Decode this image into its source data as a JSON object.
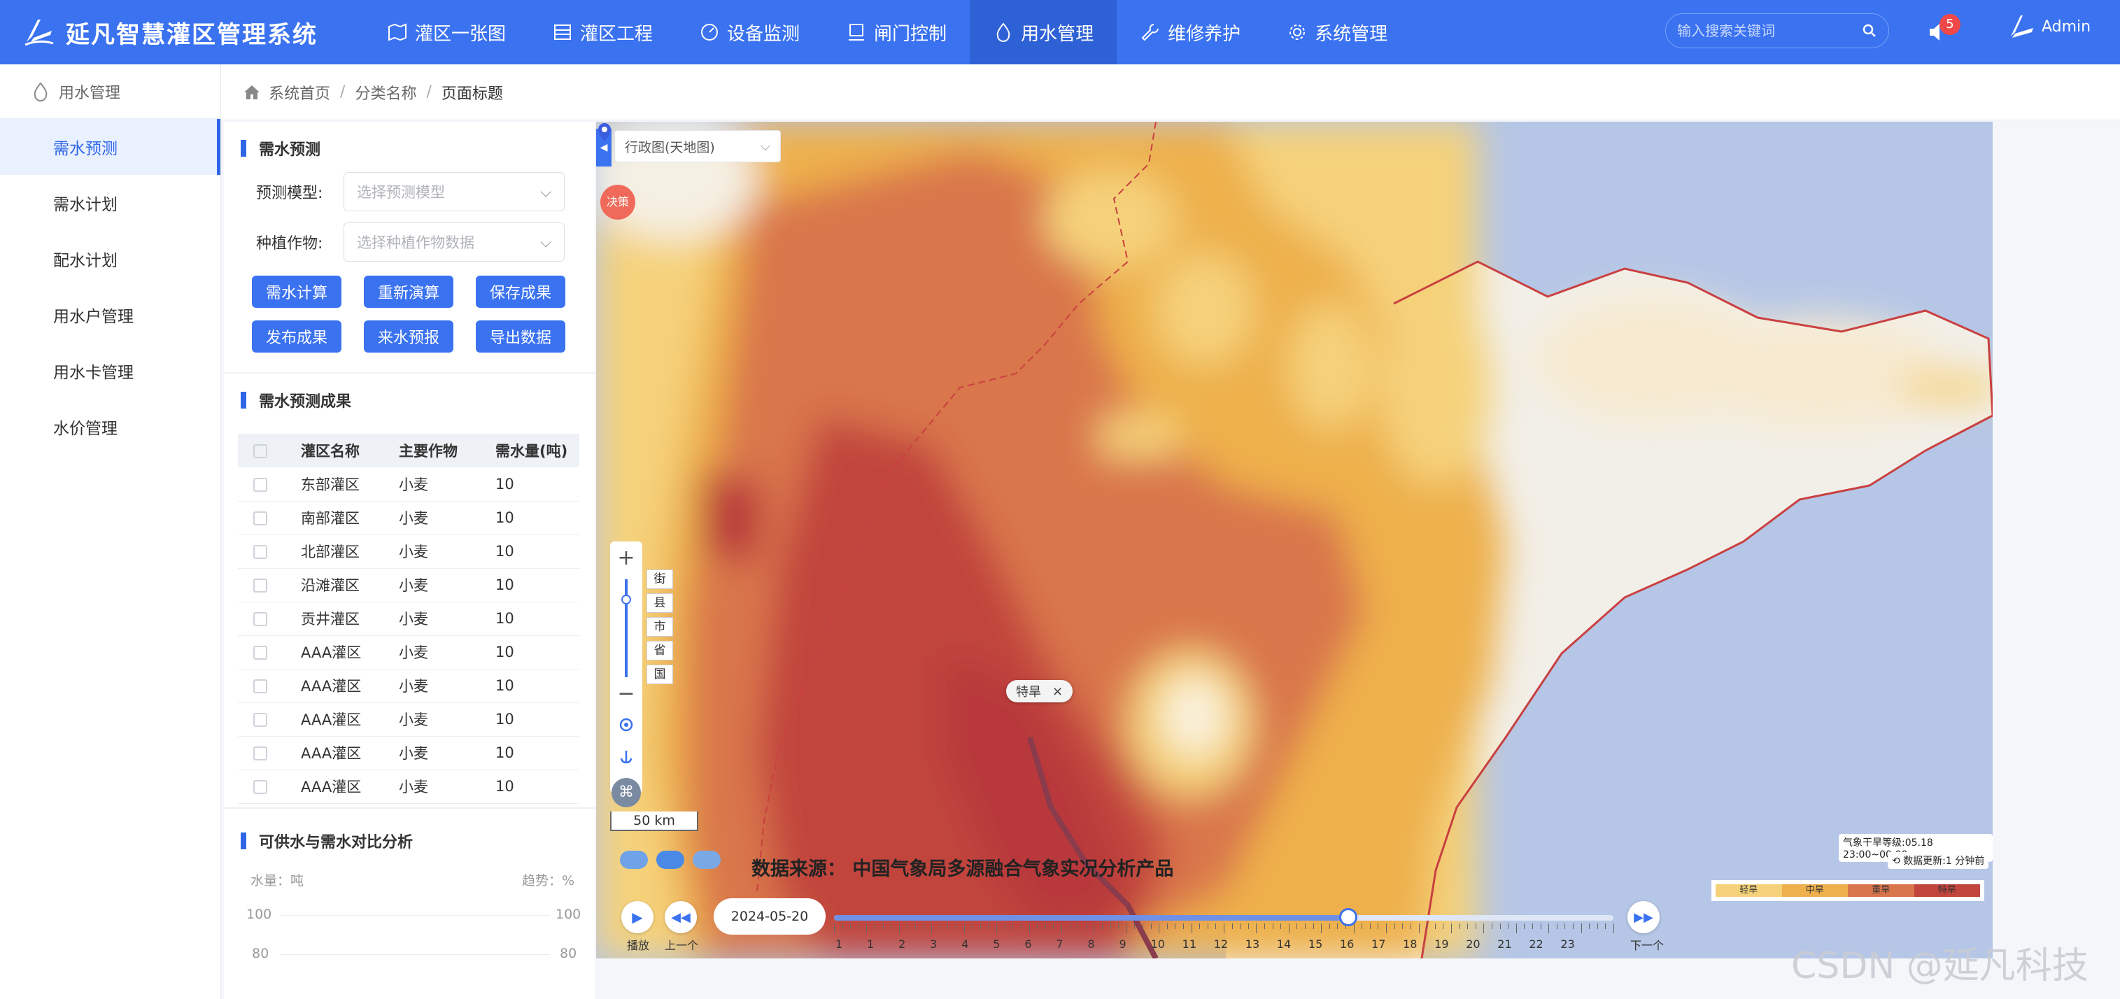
{
  "app": {
    "title": "延凡智慧灌区管理系统"
  },
  "nav": [
    {
      "label": "灌区一张图",
      "icon": "map-icon"
    },
    {
      "label": "灌区工程",
      "icon": "building-icon"
    },
    {
      "label": "设备监测",
      "icon": "monitor-icon"
    },
    {
      "label": "闸门控制",
      "icon": "gate-icon"
    },
    {
      "label": "用水管理",
      "icon": "water-drop-icon",
      "active": true
    },
    {
      "label": "维修养护",
      "icon": "wrench-icon"
    },
    {
      "label": "系统管理",
      "icon": "gear-icon"
    }
  ],
  "search": {
    "placeholder": "输入搜索关键词"
  },
  "notifications": {
    "count": "5"
  },
  "user": {
    "name": "Admin"
  },
  "sidebar": {
    "header": "用水管理",
    "items": [
      {
        "label": "需水预测",
        "active": true
      },
      {
        "label": "需水计划"
      },
      {
        "label": "配水计划"
      },
      {
        "label": "用水户管理"
      },
      {
        "label": "用水卡管理"
      },
      {
        "label": "水价管理"
      }
    ]
  },
  "breadcrumb": {
    "home": "系统首页",
    "category": "分类名称",
    "page": "页面标题"
  },
  "forecast": {
    "title": "需水预测",
    "model_label": "预测模型:",
    "model_placeholder": "选择预测模型",
    "crop_label": "种植作物:",
    "crop_placeholder": "选择种植作物数据",
    "buttons": [
      "需水计算",
      "重新演算",
      "保存成果",
      "发布成果",
      "来水预报",
      "导出数据"
    ]
  },
  "results": {
    "title": "需水预测成果",
    "columns": [
      "灌区名称",
      "主要作物",
      "需水量(吨)"
    ],
    "rows": [
      [
        "东部灌区",
        "小麦",
        "10"
      ],
      [
        "南部灌区",
        "小麦",
        "10"
      ],
      [
        "北部灌区",
        "小麦",
        "10"
      ],
      [
        "沿滩灌区",
        "小麦",
        "10"
      ],
      [
        "贡井灌区",
        "小麦",
        "10"
      ],
      [
        "AAA灌区",
        "小麦",
        "10"
      ],
      [
        "AAA灌区",
        "小麦",
        "10"
      ],
      [
        "AAA灌区",
        "小麦",
        "10"
      ],
      [
        "AAA灌区",
        "小麦",
        "10"
      ],
      [
        "AAA灌区",
        "小麦",
        "10"
      ]
    ]
  },
  "comparison": {
    "title": "可供水与需水对比分析",
    "left_unit": "水量：吨",
    "right_unit": "趋势：%",
    "left_ticks": [
      "100",
      "80"
    ],
    "right_ticks": [
      "100",
      "80"
    ]
  },
  "map": {
    "layer": "行政图(天地图)",
    "levels": [
      "街",
      "县",
      "市",
      "省",
      "国"
    ],
    "scale": "50 km",
    "source": "数据来源：  中国气象局多源融合气象实况分析产品",
    "popup": "特旱",
    "popup_close": "×",
    "badge": "决策",
    "info_line1": "气象干旱等级:05.18 23:00~00:00",
    "info_line2": "数据更新:1 分钟前",
    "legend": [
      {
        "label": "轻旱",
        "color": "#f5d27a"
      },
      {
        "label": "中旱",
        "color": "#eeb04c"
      },
      {
        "label": "重旱",
        "color": "#d9764c"
      },
      {
        "label": "特旱",
        "color": "#c1453d"
      }
    ],
    "timeline": {
      "play_label": "播放",
      "prev_label": "上一个",
      "next_label": "下一个",
      "date": "2024-05-20",
      "hours": [
        "1",
        "1",
        "2",
        "3",
        "4",
        "5",
        "6",
        "7",
        "8",
        "9",
        "10",
        "11",
        "12",
        "13",
        "14",
        "15",
        "16",
        "17",
        "18",
        "19",
        "20",
        "21",
        "22",
        "23"
      ],
      "progress": 0.66
    }
  },
  "watermark": "CSDN @延凡科技"
}
